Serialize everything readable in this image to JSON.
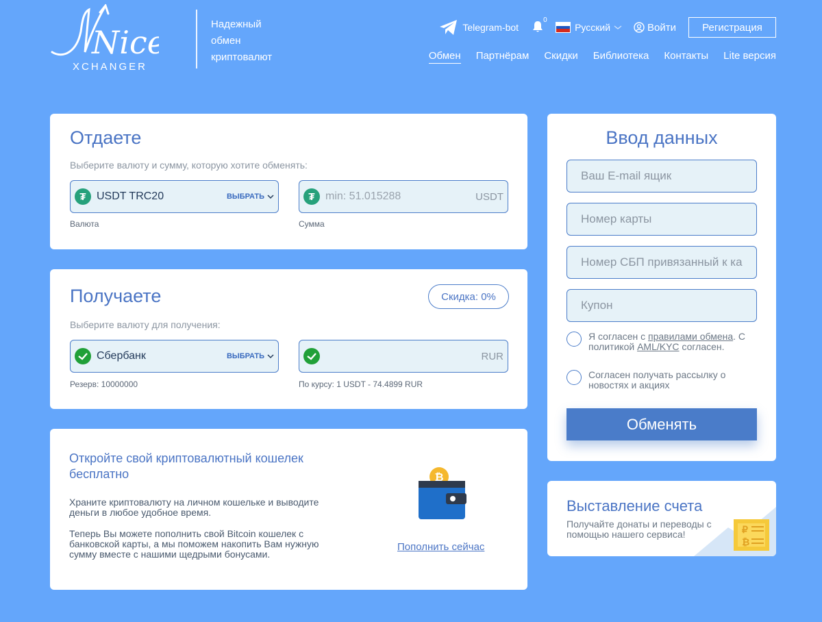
{
  "header": {
    "logo_main": "Nice",
    "logo_sub": "XCHANGER",
    "tagline": [
      "Надежный",
      "обмен",
      "криптовалют"
    ],
    "telegram": "Telegram-bot",
    "notifications": "0",
    "language": "Русский",
    "login": "Войти",
    "register": "Регистрация",
    "nav": [
      "Обмен",
      "Партнёрам",
      "Скидки",
      "Библиотека",
      "Контакты",
      "Lite версия"
    ]
  },
  "give": {
    "title": "Отдаете",
    "subtitle": "Выберите валюту и сумму, которую хотите обменять:",
    "currency": "USDT TRC20",
    "choose": "ВЫБРАТЬ",
    "amount_placeholder": "min: 51.015288",
    "amount_unit": "USDT",
    "currency_caption": "Валюта",
    "amount_caption": "Сумма"
  },
  "get": {
    "title": "Получаете",
    "discount": "Скидка: 0%",
    "subtitle": "Выберите валюту для получения:",
    "currency": "Сбербанк",
    "choose": "ВЫБРАТЬ",
    "amount_unit": "RUR",
    "reserve": "Резерв: 10000000",
    "rate": "По курсу: 1 USDT - 74.4899 RUR"
  },
  "promo": {
    "title": "Откройте свой криптовалютный кошелек бесплатно",
    "p1": "Храните криптовалюту на личном кошельке и выводите деньги в любое удобное время.",
    "p2": "Теперь Вы можете пополнить свой Bitcoin кошелек с банковской карты, а мы поможем накопить Вам нужную сумму вместе с нашими щедрыми бонусами.",
    "link": "Пополнить сейчас"
  },
  "form": {
    "title": "Ввод данных",
    "email_placeholder": "Ваш E-mail ящик",
    "card_placeholder": "Номер карты",
    "sbp_placeholder": "Номер СБП привязанный к карте",
    "coupon_placeholder": "Купон",
    "agree_pre": "Я согласен с ",
    "agree_link1": "правилами обмена",
    "agree_mid": ". С политикой ",
    "agree_link2": "AML/KYC",
    "agree_post": " согласен.",
    "newsletter": "Согласен получать рассылку о новостях и акциях",
    "submit": "Обменять"
  },
  "invoice": {
    "title": "Выставление счета",
    "text": "Получайте донаты и переводы с помощью нашего сервиса!"
  },
  "colors": {
    "background": "#64a6fb",
    "accent": "#4a7cc9",
    "usdt": "#26a17b",
    "sber": "#21a038"
  }
}
